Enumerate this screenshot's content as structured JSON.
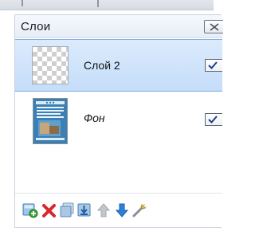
{
  "panel": {
    "title": "Слои"
  },
  "layers": [
    {
      "name": "Слой 2",
      "thumbnail": "transparent-checker",
      "visible": true,
      "selected": true
    },
    {
      "name": "Фон",
      "thumbnail": "poster-image",
      "visible": true,
      "selected": false
    }
  ],
  "toolbar": {
    "buttons": [
      {
        "icon": "new-layer-icon"
      },
      {
        "icon": "delete-icon"
      },
      {
        "icon": "duplicate-layer-icon"
      },
      {
        "icon": "merge-down-icon"
      },
      {
        "icon": "move-up-icon",
        "enabled": false
      },
      {
        "icon": "move-down-icon"
      },
      {
        "icon": "layer-properties-icon"
      }
    ]
  },
  "colors": {
    "selection_top": "#dcebfc",
    "selection_bottom": "#c4ddfa",
    "selection_border": "#84acdd",
    "delete_red": "#d8262c",
    "arrow_blue": "#2f7fd8",
    "add_green": "#3aa53a"
  }
}
